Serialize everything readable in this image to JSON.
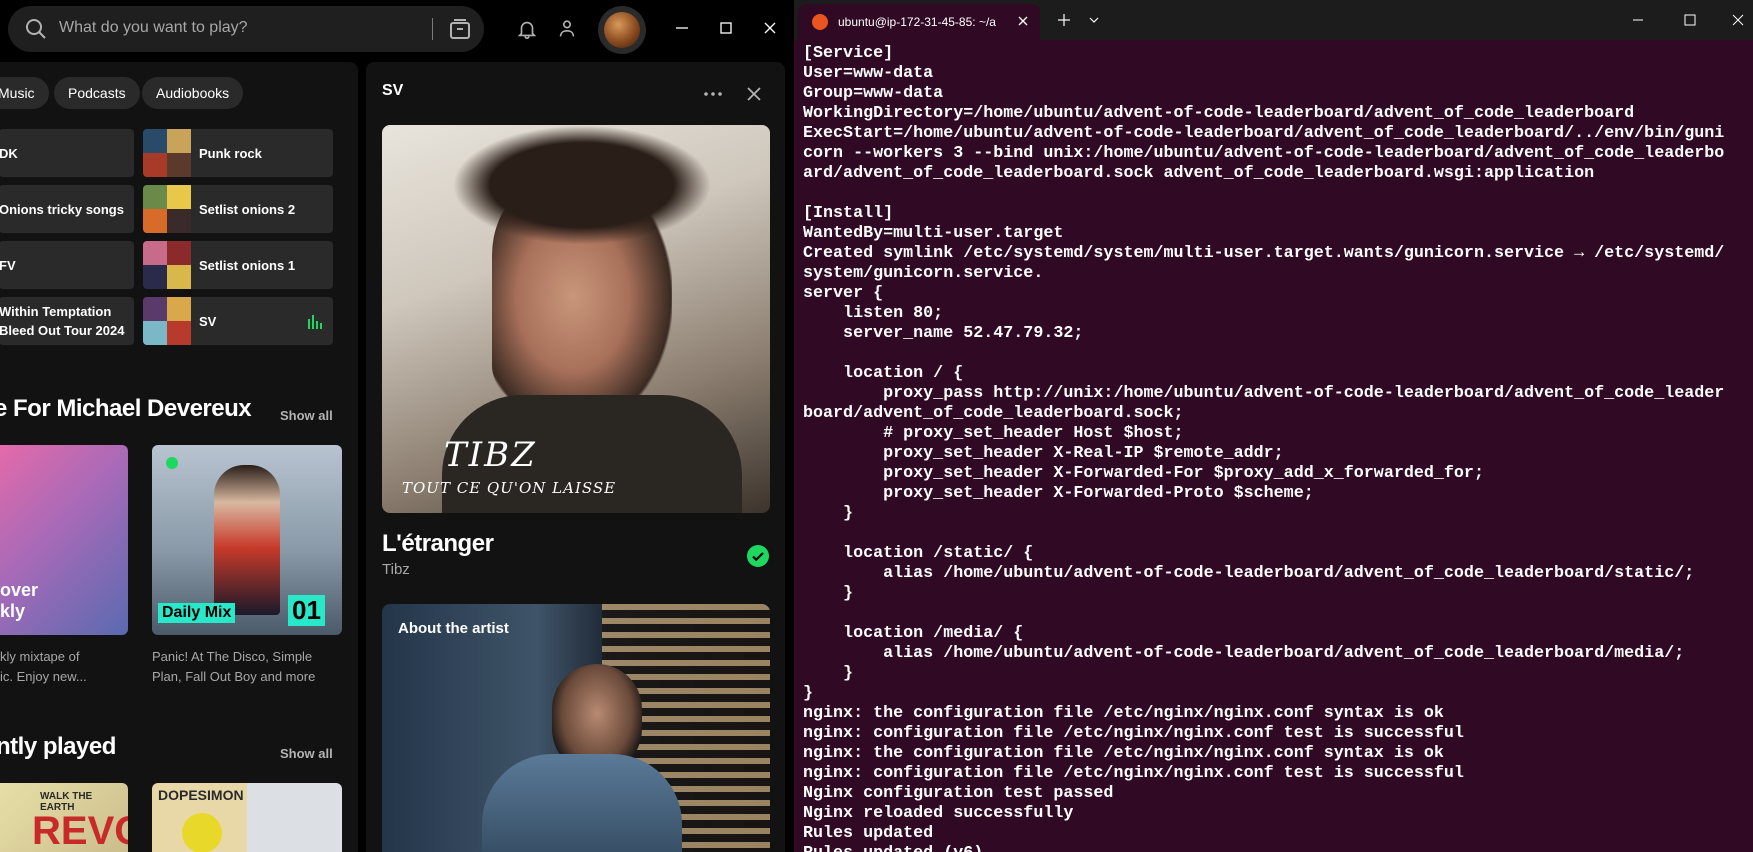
{
  "spotify": {
    "search_placeholder": "What do you want to play?",
    "chips": [
      "Music",
      "Podcasts",
      "Audiobooks"
    ],
    "quick_left": [
      "DK",
      "Onions tricky songs",
      "FV",
      "Within Temptation",
      "Bleed Out Tour 2024"
    ],
    "quick_right": [
      "Punk rock",
      "Setlist onions 2",
      "Setlist onions 1",
      "SV"
    ],
    "section1_title": "e For Michael Devereux",
    "section1_show_all": "Show all",
    "card1": {
      "overlay_line1": "over",
      "overlay_line2": "kly",
      "desc_line1": "kly mixtape of",
      "desc_line2": "ic. Enjoy new..."
    },
    "card2": {
      "badge": "Daily Mix",
      "number": "01",
      "desc_line1": "Panic! At The Disco, Simple",
      "desc_line2": "Plan, Fall Out Boy and more"
    },
    "section2_title": "ntly played",
    "section2_show_all": "Show all",
    "recent_card_text": "REVO",
    "recent_card_text2": "WALK THE EARTH",
    "recent_card_text3": "DOPESIMON",
    "now_playing": {
      "panel_title": "SV",
      "cover_artist_script": "TIBZ",
      "cover_album_script": "TOUT CE QU'ON LAISSE",
      "song": "L'étranger",
      "artist": "Tibz",
      "about_title": "About the artist"
    }
  },
  "terminal": {
    "tab_title": "ubuntu@ip-172-31-45-85: ~/a",
    "lines": [
      "[Service]",
      "User=www-data",
      "Group=www-data",
      "WorkingDirectory=/home/ubuntu/advent-of-code-leaderboard/advent_of_code_leaderboard",
      "ExecStart=/home/ubuntu/advent-of-code-leaderboard/advent_of_code_leaderboard/../env/bin/guni",
      "corn --workers 3 --bind unix:/home/ubuntu/advent-of-code-leaderboard/advent_of_code_leaderbo",
      "ard/advent_of_code_leaderboard.sock advent_of_code_leaderboard.wsgi:application",
      "",
      "[Install]",
      "WantedBy=multi-user.target",
      "Created symlink /etc/systemd/system/multi-user.target.wants/gunicorn.service → /etc/systemd/",
      "system/gunicorn.service.",
      "server {",
      "    listen 80;",
      "    server_name 52.47.79.32;",
      "",
      "    location / {",
      "        proxy_pass http://unix:/home/ubuntu/advent-of-code-leaderboard/advent_of_code_leader",
      "board/advent_of_code_leaderboard.sock;",
      "        # proxy_set_header Host $host;",
      "        proxy_set_header X-Real-IP $remote_addr;",
      "        proxy_set_header X-Forwarded-For $proxy_add_x_forwarded_for;",
      "        proxy_set_header X-Forwarded-Proto $scheme;",
      "    }",
      "",
      "    location /static/ {",
      "        alias /home/ubuntu/advent-of-code-leaderboard/advent_of_code_leaderboard/static/;",
      "    }",
      "",
      "    location /media/ {",
      "        alias /home/ubuntu/advent-of-code-leaderboard/advent_of_code_leaderboard/media/;",
      "    }",
      "}",
      "nginx: the configuration file /etc/nginx/nginx.conf syntax is ok",
      "nginx: configuration file /etc/nginx/nginx.conf test is successful",
      "nginx: the configuration file /etc/nginx/nginx.conf syntax is ok",
      "nginx: configuration file /etc/nginx/nginx.conf test is successful",
      "Nginx configuration test passed",
      "Nginx reloaded successfully",
      "Rules updated",
      "Rules updated (v6)"
    ]
  },
  "colors": {
    "spotify_green": "#1ed760",
    "terminal_bg": "#300a24",
    "ubuntu_orange": "#e95420"
  }
}
